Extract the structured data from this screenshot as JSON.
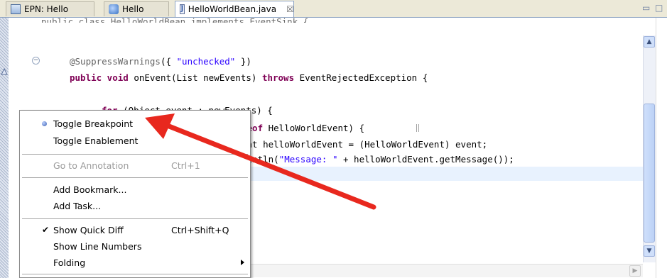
{
  "tabs": [
    {
      "label": "EPN: Hello",
      "icon": "epn-diagram-icon",
      "active": false
    },
    {
      "label": "Hello",
      "icon": "hello-assembly-icon",
      "active": false
    },
    {
      "label": "HelloWorldBean.java",
      "icon": "java-file-icon",
      "active": true,
      "close": "☒"
    }
  ],
  "window_controls": {
    "minimize": "▭",
    "maximize": "□"
  },
  "code": {
    "line_top_partial": "public class HelloWorldBean implements EventSink {",
    "annotation": "@SuppressWarnings",
    "annotation_open": "({ ",
    "annotation_string": "\"unchecked\"",
    "annotation_close": " })",
    "method_kw": "public void",
    "method_sig": " onEvent(List newEvents) ",
    "throws_kw": "throws",
    "throws_rest": " EventRejectedException {",
    "for_kw": "for",
    "for_rest": " (Object event : newEvents) {",
    "ceof_kw": "ceof",
    "ceof_rest": " HelloWorldEvent) {",
    "assign": "ent helloWorldEvent = (HelloWorldEvent) event;",
    "print_pre": "rintln(",
    "print_str": "\"Message: \"",
    "print_post": " + helloWorldEvent.getMessage());"
  },
  "context_menu": {
    "items": [
      {
        "label": "Toggle Breakpoint",
        "marker": "dot"
      },
      {
        "label": "Toggle Enablement"
      },
      {
        "label": "Go to Annotation",
        "accelerator": "Ctrl+1",
        "disabled": true
      },
      {
        "label": "Add Bookmark..."
      },
      {
        "label": "Add Task..."
      },
      {
        "label": "Show Quick Diff",
        "accelerator": "Ctrl+Shift+Q",
        "marker": "check",
        "check": "✔"
      },
      {
        "label": "Show Line Numbers"
      },
      {
        "label": "Folding",
        "submenu": true
      }
    ]
  },
  "colors": {
    "keyword": "#7f0055",
    "string": "#2a00ff",
    "annotation": "#646464",
    "arrow": "#e8281e",
    "current_line": "#e8f2fe"
  }
}
